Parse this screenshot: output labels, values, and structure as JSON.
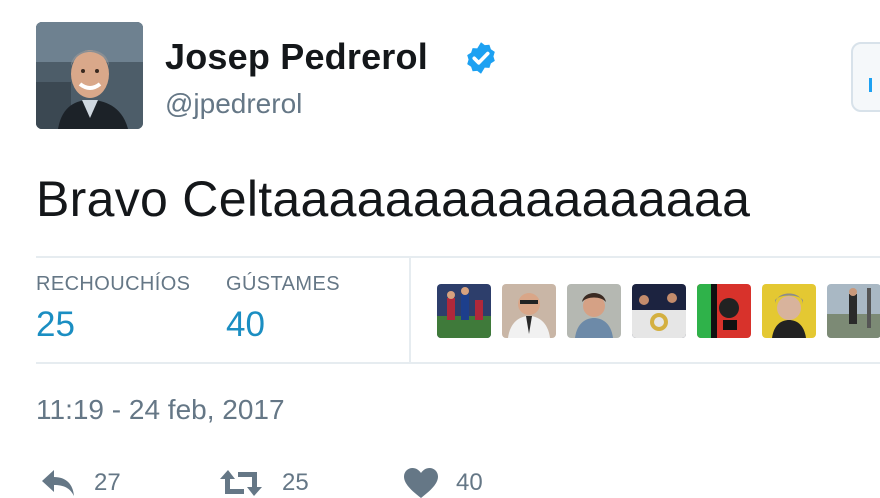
{
  "tweet": {
    "display_name": "Josep Pedrerol",
    "screen_name": "@jpedrerol",
    "verified": true,
    "text": "Bravo Celtaaaaaaaaaaaaaaaaa",
    "timestamp": "11:19 - 24 feb, 2017"
  },
  "stats": {
    "retweets_label": "RECHOUCHÍOS",
    "retweets_value": "25",
    "likes_label": "GÚSTAMES",
    "likes_value": "40"
  },
  "actions": {
    "reply_count": "27",
    "retweet_count": "25",
    "like_count": "40"
  },
  "icons": {
    "verified": "verified-badge-icon",
    "reply": "reply-icon",
    "retweet": "retweet-icon",
    "like": "heart-icon"
  },
  "colors": {
    "accent": "#1da1f2",
    "stat_value": "#1b8ec2",
    "muted": "#657786",
    "text": "#14171a"
  }
}
